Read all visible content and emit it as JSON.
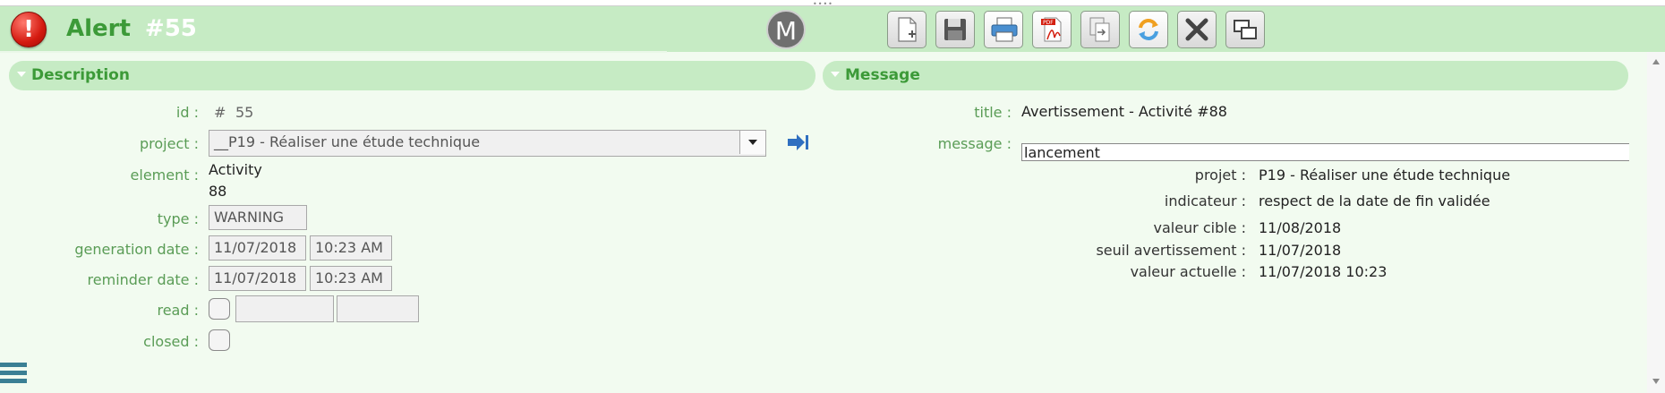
{
  "header": {
    "title": "Alert",
    "number": "#55",
    "avatar_letter": "M",
    "toolbar": [
      {
        "name": "new",
        "icon": "new-document-icon"
      },
      {
        "name": "save",
        "icon": "floppy-disk-icon"
      },
      {
        "name": "print",
        "icon": "printer-icon"
      },
      {
        "name": "pdf",
        "icon": "pdf-icon"
      },
      {
        "name": "copy",
        "icon": "copy-document-icon"
      },
      {
        "name": "refresh",
        "icon": "refresh-icon"
      },
      {
        "name": "delete",
        "icon": "x-icon"
      },
      {
        "name": "multi-window",
        "icon": "windows-icon"
      }
    ]
  },
  "description": {
    "section_label": "Description",
    "id_label": "id :",
    "id_hash": "#",
    "id_value": "55",
    "project_label": "project :",
    "project_value": "__P19 - Réaliser une étude technique",
    "element_label": "element :",
    "element_type": "Activity",
    "element_id": "88",
    "type_label": "type :",
    "type_value": "WARNING",
    "generation_label": "generation date :",
    "generation_date": "11/07/2018",
    "generation_time": "10:23 AM",
    "reminder_label": "reminder date :",
    "reminder_date": "11/07/2018",
    "reminder_time": "10:23 AM",
    "read_label": "read :",
    "closed_label": "closed :"
  },
  "message": {
    "section_label": "Message",
    "title_label": "title :",
    "title_value": "Avertissement - Activité #88",
    "message_label": "message :",
    "message_first_line": "lancement",
    "details": [
      {
        "label": "projet :",
        "value": "P19 - Réaliser une étude technique"
      },
      {
        "label": "indicateur :",
        "value": "respect de la date de fin validée"
      },
      {
        "label": "valeur cible :",
        "value": "11/08/2018"
      },
      {
        "label": "seuil avertissement :",
        "value": "11/07/2018"
      },
      {
        "label": "valeur actuelle :",
        "value": "11/07/2018 10:23"
      }
    ]
  }
}
